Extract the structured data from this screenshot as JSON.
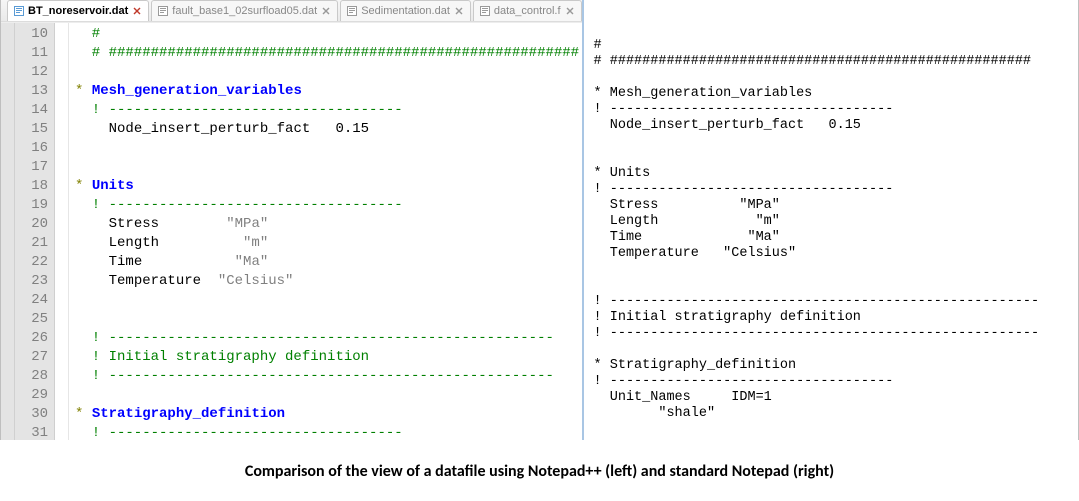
{
  "caption": "Comparison of the view of a datafile using Notepad++ (left) and standard Notepad (right)",
  "tabs": {
    "t0": {
      "label": "BT_noreservoir.dat"
    },
    "t1": {
      "label": "fault_base1_02surfload05.dat"
    },
    "t2": {
      "label": "Sedimentation.dat"
    },
    "t3": {
      "label": "data_control.f"
    }
  },
  "gutter": {
    "l10": "10",
    "l11": "11",
    "l12": "12",
    "l13": "13",
    "l14": "14",
    "l15": "15",
    "l16": "16",
    "l17": "17",
    "l18": "18",
    "l19": "19",
    "l20": "20",
    "l21": "21",
    "l22": "22",
    "l23": "23",
    "l24": "24",
    "l25": "25",
    "l26": "26",
    "l27": "27",
    "l28": "28",
    "l29": "29",
    "l30": "30",
    "l31": "31"
  },
  "npp": {
    "l10": "  #",
    "l11": "  # ########################################################",
    "l12": "",
    "l13": {
      "prefix": "* ",
      "keyword": "Mesh_generation_variables"
    },
    "l14": "  ! -----------------------------------",
    "l15": {
      "indent": "    ",
      "key": "Node_insert_perturb_fact",
      "sep": "   ",
      "val": "0.15"
    },
    "l16": "",
    "l17": "",
    "l18": {
      "prefix": "* ",
      "keyword": "Units"
    },
    "l19": "  ! -----------------------------------",
    "l20": {
      "indent": "    ",
      "key": "Stress        ",
      "val": "\"MPa\""
    },
    "l21": {
      "indent": "    ",
      "key": "Length          ",
      "val": "\"m\""
    },
    "l22": {
      "indent": "    ",
      "key": "Time           ",
      "val": "\"Ma\""
    },
    "l23": {
      "indent": "    ",
      "key": "Temperature  ",
      "val": "\"Celsius\""
    },
    "l24": "",
    "l25": "",
    "l26": "  ! -----------------------------------------------------",
    "l27": "  ! Initial stratigraphy definition",
    "l28": "  ! -----------------------------------------------------",
    "l29": "",
    "l30": {
      "prefix": "* ",
      "keyword": "Stratigraphy_definition"
    },
    "l31": "  ! -----------------------------------"
  },
  "notepad": {
    "body": "#\n# ####################################################\n\n* Mesh_generation_variables\n! -----------------------------------\n  Node_insert_perturb_fact   0.15\n\n\n* Units\n! -----------------------------------\n  Stress          \"MPa\"\n  Length            \"m\"\n  Time             \"Ma\"\n  Temperature   \"Celsius\"\n\n\n! -----------------------------------------------------\n! Initial stratigraphy definition\n! -----------------------------------------------------\n\n* Stratigraphy_definition\n! -----------------------------------\n  Unit_Names     IDM=1\n        \"shale\""
  }
}
